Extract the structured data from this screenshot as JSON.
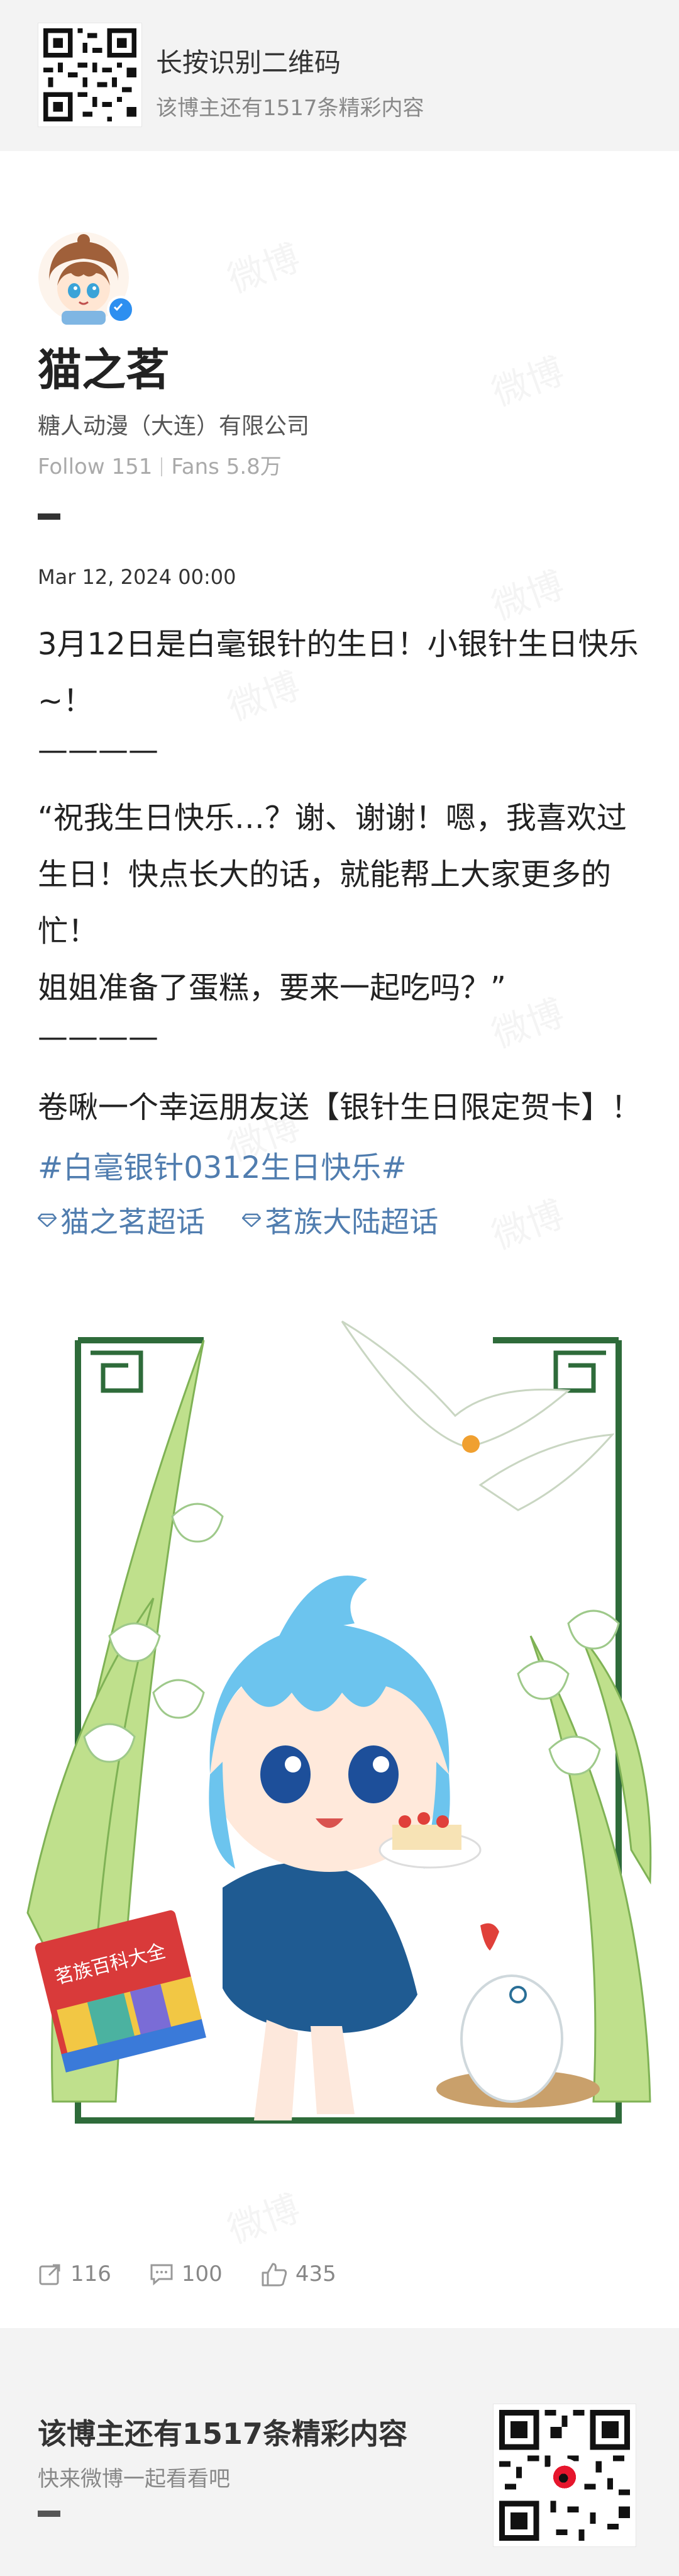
{
  "top_banner": {
    "title": "长按识别二维码",
    "subtitle": "该博主还有1517条精彩内容"
  },
  "profile": {
    "name": "猫之茗",
    "org": "糖人动漫（大连）有限公司",
    "follow_label": "Follow 151",
    "fans_label": "Fans 5.8万",
    "verified_icon": "verified-badge-icon",
    "verified_color": "#2d8ff0"
  },
  "post": {
    "date": "Mar 12, 2024 00:00",
    "lines": [
      "3月12日是白毫银针的生日！小银针生日快乐",
      "~！",
      "————",
      "“祝我生日快乐…？谢、谢谢！嗯，我喜欢过",
      "生日！快点长大的话，就能帮上大家更多的",
      "忙！",
      "姐姐准备了蛋糕，要来一起吃吗？”",
      "————",
      "卷啾一个幸运朋友送【银针生日限定贺卡】！"
    ],
    "hashtag": "#白毫银针0312生日快乐#",
    "topics": [
      "猫之茗超话",
      "茗族大陆超话"
    ],
    "link_color": "#507daf"
  },
  "illustration": {
    "book_text": "茗族百科大全"
  },
  "actions": {
    "reposts": "116",
    "comments": "100",
    "likes": "435"
  },
  "bottom_banner": {
    "title": "该博主还有1517条精彩内容",
    "subtitle": "快来微博一起看看吧"
  },
  "watermark": "微博"
}
